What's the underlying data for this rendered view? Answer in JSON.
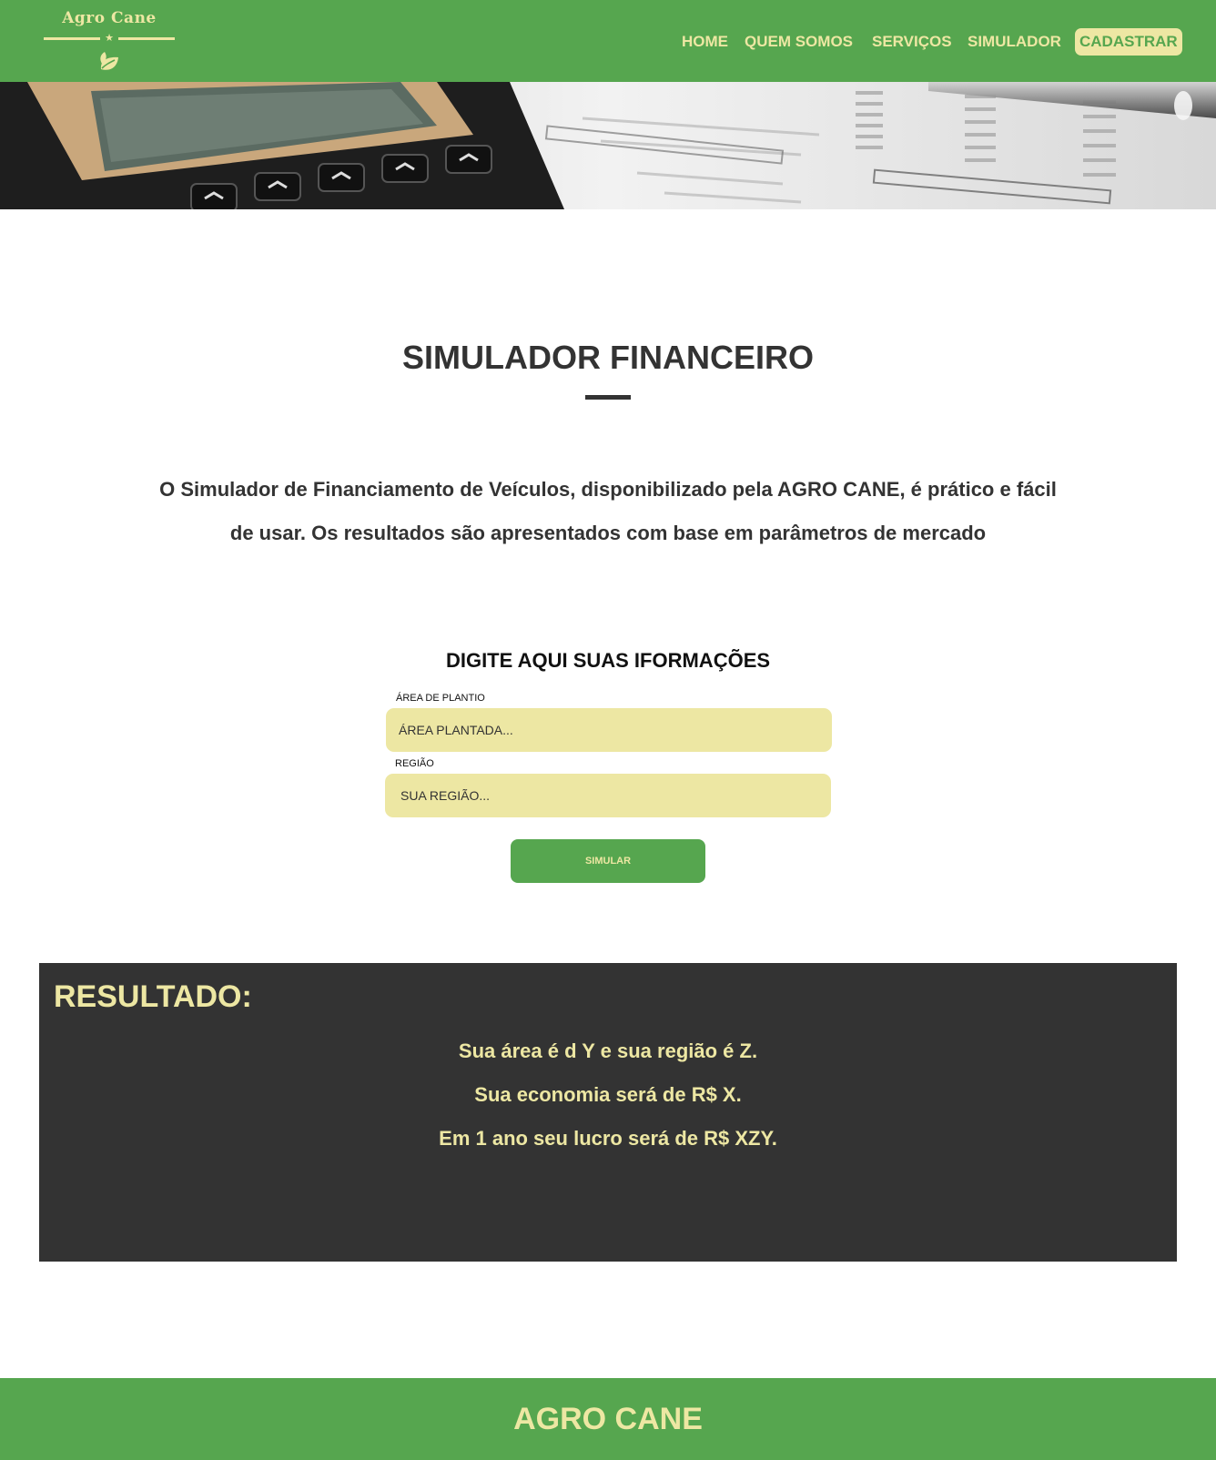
{
  "brand": {
    "logo_text": "Agro Cane"
  },
  "nav": {
    "items": [
      "HOME",
      "QUEM SOMOS",
      "SERVIÇOS",
      "SIMULADOR"
    ],
    "cta": "CADASTRAR"
  },
  "colors": {
    "brand_green": "#56a64f",
    "accent_cream": "#ede7a3",
    "dark": "#333333"
  },
  "banner": {
    "image": "calculator-and-financial-sheet-photo"
  },
  "main": {
    "title": "SIMULADOR FINANCEIRO",
    "intro": "O Simulador de Financiamento de Veículos, disponibilizado pela AGRO CANE, é prático e fácil de usar. Os resultados são apresentados com base em parâmetros de mercado"
  },
  "form": {
    "title": "DIGITE AQUI SUAS IFORMAÇÕES",
    "area_label": "ÁREA DE PLANTIO",
    "area_placeholder": "ÁREA PLANTADA...",
    "region_label": "REGIÃO",
    "region_placeholder": "SUA REGIÃO...",
    "submit_label": "SIMULAR"
  },
  "result": {
    "title": "RESULTADO:",
    "lines": [
      "Sua área é d Y e sua região é Z.",
      "Sua economia será de R$ X.",
      "Em 1 ano seu lucro será de R$ XZY."
    ]
  },
  "footer": {
    "title": "AGRO CANE"
  }
}
